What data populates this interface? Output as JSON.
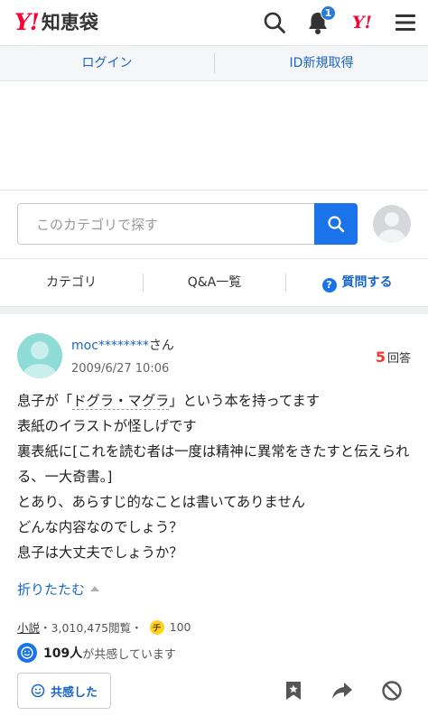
{
  "header": {
    "logo_y": "Y!",
    "logo_text": "知恵袋",
    "notification_count": "1",
    "yahoo_mark": "Y!"
  },
  "login_bar": {
    "login": "ログイン",
    "register": "ID新規取得"
  },
  "search": {
    "placeholder": "このカテゴリで探す"
  },
  "category_nav": {
    "category": "カテゴリ",
    "qa_list": "Q&A一覧",
    "ask_icon": "?",
    "ask": "質問する"
  },
  "question": {
    "user": "moc********",
    "honorific": "さん",
    "date": "2009/6/27 10:06",
    "answer_count": "5",
    "answer_label": "回答",
    "body": {
      "l1_a": "息子が「",
      "l1_link": "ドグラ・マグラ",
      "l1_b": "」という本を持ってます",
      "l2": "表紙のイラストが怪しげです",
      "l3": "裏表紙に[これを読む者は一度は精神に異常をきたすと伝えられる、一大奇書。]",
      "l4": "とあり、あらすじ的なことは書いてありません",
      "l5": "どんな内容なのでしょう？",
      "l6": "息子は大丈夫でしょうか？"
    },
    "fold": "折りたたむ",
    "category": "小説",
    "views": "・3,010,475閲覧・",
    "coin_icon": "チ",
    "coins": "100",
    "empathy_count": "109人",
    "empathy_text": "が共感しています",
    "empathy_button": "共感した"
  },
  "colors": {
    "brand_red": "#ff0033",
    "link_blue": "#1a66c8",
    "button_blue": "#1a73e8"
  }
}
